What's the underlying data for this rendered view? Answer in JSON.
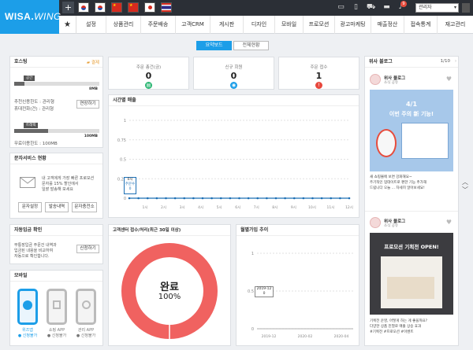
{
  "app": {
    "logo_main": "WISA.",
    "logo_italic": "WING"
  },
  "topbar": {
    "plus": "+",
    "notification_count": "9",
    "lang_value": "관리자",
    "caret": "▾"
  },
  "flags": [
    {
      "name": "korea-flag-icon",
      "color": "#ffffff"
    },
    {
      "name": "korea-flag-icon-2",
      "color": "#ffffff"
    },
    {
      "name": "china-flag-icon",
      "color": "#d62a1e"
    },
    {
      "name": "china-flag-icon-2",
      "color": "#d62a1e"
    },
    {
      "name": "japan-flag-icon",
      "color": "#ffffff"
    },
    {
      "name": "thailand-flag-icon",
      "color": "#2d2a8a"
    }
  ],
  "nav": {
    "star": "★",
    "items": [
      "설정",
      "상품관리",
      "주문배송",
      "고객CRM",
      "게시판",
      "디자인",
      "모바일",
      "프로모션",
      "광고마케팅",
      "매출정산",
      "접속통계",
      "재고관리"
    ]
  },
  "tabs": {
    "left": "요약보드",
    "right": "전체현황"
  },
  "shop_panel": {
    "title": "호스팅",
    "badge": "결제",
    "bar1_label": "공간",
    "bar1_value": "8MB",
    "line1": "추천신용한도 : 관리형",
    "line2": "휴대전화(건) : 관리형",
    "renew_button": "연장하기",
    "bar2_label": "트래픽",
    "bar2_value": "100MB",
    "line3": "무료이용한도 : 100MB",
    "bar1_fill": 0.12,
    "bar2_fill": 0.4
  },
  "sms_panel": {
    "title": "문자서비스 현황",
    "desc1": "내 고객에게 가장 빠른 프로모션",
    "desc2": "문자를 15% 할인에서",
    "desc3": "일괄 발송해 보세요",
    "buttons": [
      "문자설정",
      "발송내역",
      "문자충전소"
    ]
  },
  "auto_panel": {
    "title": "자동입금 확인",
    "line1": "무통장입금 주문건 내역과",
    "line2": "입금된 내용을 비교하여",
    "line3": "자동으로 확인합니다.",
    "button": "신청하기"
  },
  "mobile_panel": {
    "title": "모바일",
    "phones": [
      {
        "name": "위즈앱",
        "sub": "● 신청불가",
        "color": "#1c9ee8"
      },
      {
        "name": "쇼핑 APP",
        "sub": "● 신청불가",
        "color": "#bbbbbb"
      },
      {
        "name": "관리 APP",
        "sub": "● 신청불가",
        "color": "#bbbbbb"
      }
    ]
  },
  "stats": [
    {
      "label": "주문 총건(금)",
      "value": "0",
      "color": "#2bb673",
      "icon": "▤"
    },
    {
      "label": "신규 회원",
      "value": "0",
      "color": "#1c9ee8",
      "icon": "◉"
    },
    {
      "label": "주문 접수",
      "value": "1",
      "color": "#e8483d",
      "icon": "!"
    }
  ],
  "sales_chart": {
    "title": "시간별 매출",
    "tooltip": "0시",
    "tooltip_sub1": "주문수",
    "tooltip_sub2": "0"
  },
  "chart_data": [
    {
      "type": "line",
      "title": "시간별 매출",
      "y_ticks": [
        "1",
        "0.75",
        "0.5",
        "0.25",
        "0"
      ],
      "x_ticks": [
        "1시",
        "2시",
        "3시",
        "4시",
        "5시",
        "6시",
        "7시",
        "8시",
        "9시",
        "10시",
        "11시",
        "12시"
      ],
      "x": [
        0,
        1,
        2,
        3,
        4,
        5,
        6,
        7,
        8,
        9,
        10,
        11,
        12,
        13,
        14,
        15,
        16,
        17,
        18,
        19,
        20,
        21,
        22,
        23,
        24
      ],
      "series": [
        {
          "values": [
            0,
            0,
            0,
            0,
            0,
            0,
            0,
            0,
            0,
            0,
            0,
            0,
            0,
            0,
            0,
            0,
            0,
            0,
            0,
            0,
            0,
            0,
            0,
            0,
            0
          ]
        }
      ],
      "ylim": [
        0,
        1
      ],
      "color": "#1c6fb5"
    },
    {
      "type": "pie",
      "title": "고객센터 접수/처리(최근 30일 이상)",
      "slices": [
        {
          "name": "완료",
          "value": 100
        }
      ],
      "center_label": "완료",
      "center_value": "100%",
      "color": "#f06260"
    },
    {
      "type": "line",
      "title": "월별가입 추이",
      "y_ticks": [
        "1",
        "0.5",
        "0"
      ],
      "x_ticks": [
        "2019-12",
        "2020-02",
        "2020-04"
      ],
      "tooltip": "2019-12",
      "tooltip_sub": "0",
      "ylim": [
        0,
        1
      ]
    }
  ],
  "right_panel": {
    "title": "위사 블로그",
    "page": "1/10",
    "posts": [
      {
        "author": "위사 블로그",
        "sub": "소식 공유",
        "img_title": "4/1",
        "img_sub": "이번 주의 新 기능!",
        "text1": "새 쇼핑몰에 보면 강화해요~",
        "text2": "주기적인 업데이트로 편한 기능 추가해",
        "text3": "드립니다 오늘 ... 자세히 알아보세요!",
        "text4": "",
        "img_color": "#a7c8ea"
      },
      {
        "author": "위사 블로그",
        "sub": "소식 공유",
        "img_title": "프로모션 기획전 OPEN!",
        "img_sub": "",
        "text1": "기획전 운영, 어떻게 하는 게 좋을까요?",
        "text2": "다양한 상품 진열로 매출 상승 효과",
        "text3": "#기획전 #프로모션 #이벤트",
        "text4": "",
        "img_color": "#3c3c40"
      }
    ],
    "nav_up": "︿",
    "nav_down": "﹀"
  }
}
